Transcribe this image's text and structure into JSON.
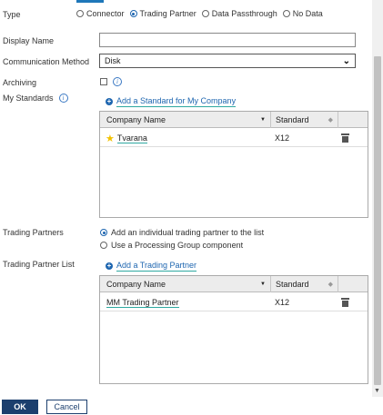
{
  "type_row": {
    "label": "Type",
    "options": [
      "Connector",
      "Trading Partner",
      "Data Passthrough",
      "No Data"
    ],
    "selected": "Trading Partner"
  },
  "display_name": {
    "label": "Display Name",
    "value": ""
  },
  "communication_method": {
    "label": "Communication Method",
    "value": "Disk"
  },
  "archiving": {
    "label": "Archiving",
    "checked": false
  },
  "my_standards": {
    "label": "My Standards",
    "add_link": "Add a Standard for My Company",
    "columns": [
      "Company Name",
      "Standard"
    ],
    "rows": [
      {
        "company": "Tvarana",
        "standard": "X12",
        "starred": true
      }
    ]
  },
  "trading_partners": {
    "label": "Trading Partners",
    "options": [
      "Add an individual trading partner to the list",
      "Use a Processing Group component"
    ],
    "selected": "Add an individual trading partner to the list"
  },
  "trading_partner_list": {
    "label": "Trading Partner List",
    "add_link": "Add a Trading Partner",
    "columns": [
      "Company Name",
      "Standard"
    ],
    "rows": [
      {
        "company": "MM Trading Partner",
        "standard": "X12"
      }
    ]
  },
  "footer": {
    "ok_label": "OK",
    "cancel_label": "Cancel"
  },
  "colors": {
    "accent": "#1e66b0",
    "button_dark": "#1c3f6e",
    "link_underline": "#2ea8a0",
    "star": "#f2c200"
  }
}
